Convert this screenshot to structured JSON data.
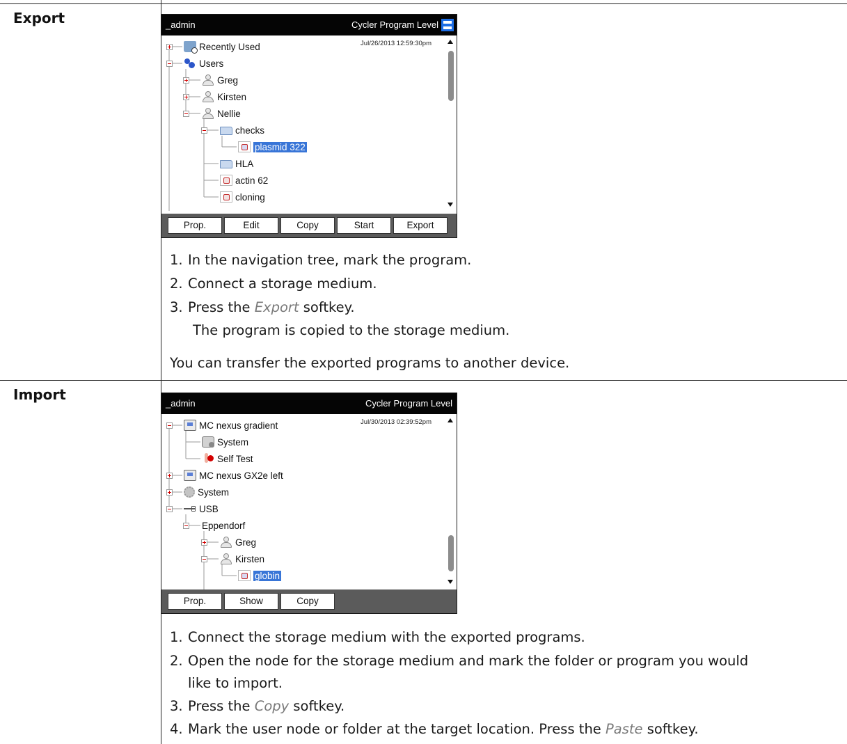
{
  "export_section": {
    "label": "Export",
    "screen": {
      "user": "_admin",
      "level": "Cycler Program Level",
      "date": "Jul/26/2013 12:59:30pm",
      "nodes": [
        {
          "label": "Recently Used"
        },
        {
          "label": "Users"
        },
        {
          "label": "Greg"
        },
        {
          "label": "Kirsten"
        },
        {
          "label": "Nellie"
        },
        {
          "label": "checks"
        },
        {
          "label": "plasmid 322"
        },
        {
          "label": "HLA"
        },
        {
          "label": "actin 62"
        },
        {
          "label": "cloning"
        }
      ],
      "softkeys": [
        "Prop.",
        "Edit",
        "Copy",
        "Start",
        "Export"
      ]
    },
    "steps": [
      {
        "num": "1.",
        "text": "In the navigation tree, mark the program."
      },
      {
        "num": "2.",
        "text": "Connect a storage medium."
      },
      {
        "num": "3.",
        "pre": "Press the ",
        "em": "Export",
        "post": " softkey."
      }
    ],
    "result": "The program is copied to the storage medium.",
    "note": "You can transfer the exported programs to another device."
  },
  "import_section": {
    "label": "Import",
    "screen": {
      "user": "_admin",
      "level": "Cycler Program Level",
      "date": "Jul/30/2013 02:39:52pm",
      "nodes": [
        {
          "label": "MC nexus gradient"
        },
        {
          "label": "System"
        },
        {
          "label": "Self Test"
        },
        {
          "label": "MC nexus GX2e left"
        },
        {
          "label": "System"
        },
        {
          "label": "USB"
        },
        {
          "label": "Eppendorf"
        },
        {
          "label": "Greg"
        },
        {
          "label": "Kirsten"
        },
        {
          "label": "globin"
        }
      ],
      "softkeys": [
        "Prop.",
        "Show",
        "Copy"
      ]
    },
    "steps": [
      {
        "num": "1.",
        "text": "Connect the storage medium with the exported programs."
      },
      {
        "num": "2.",
        "text": "Open the node for the storage medium and mark the folder or program you would",
        "text2": "like to import."
      },
      {
        "num": "3.",
        "pre": "Press the ",
        "em": "Copy",
        "post": " softkey."
      },
      {
        "num": "4.",
        "pre": "Mark the user node or folder at the target location. Press the ",
        "em": "Paste",
        "post": " softkey."
      }
    ]
  }
}
